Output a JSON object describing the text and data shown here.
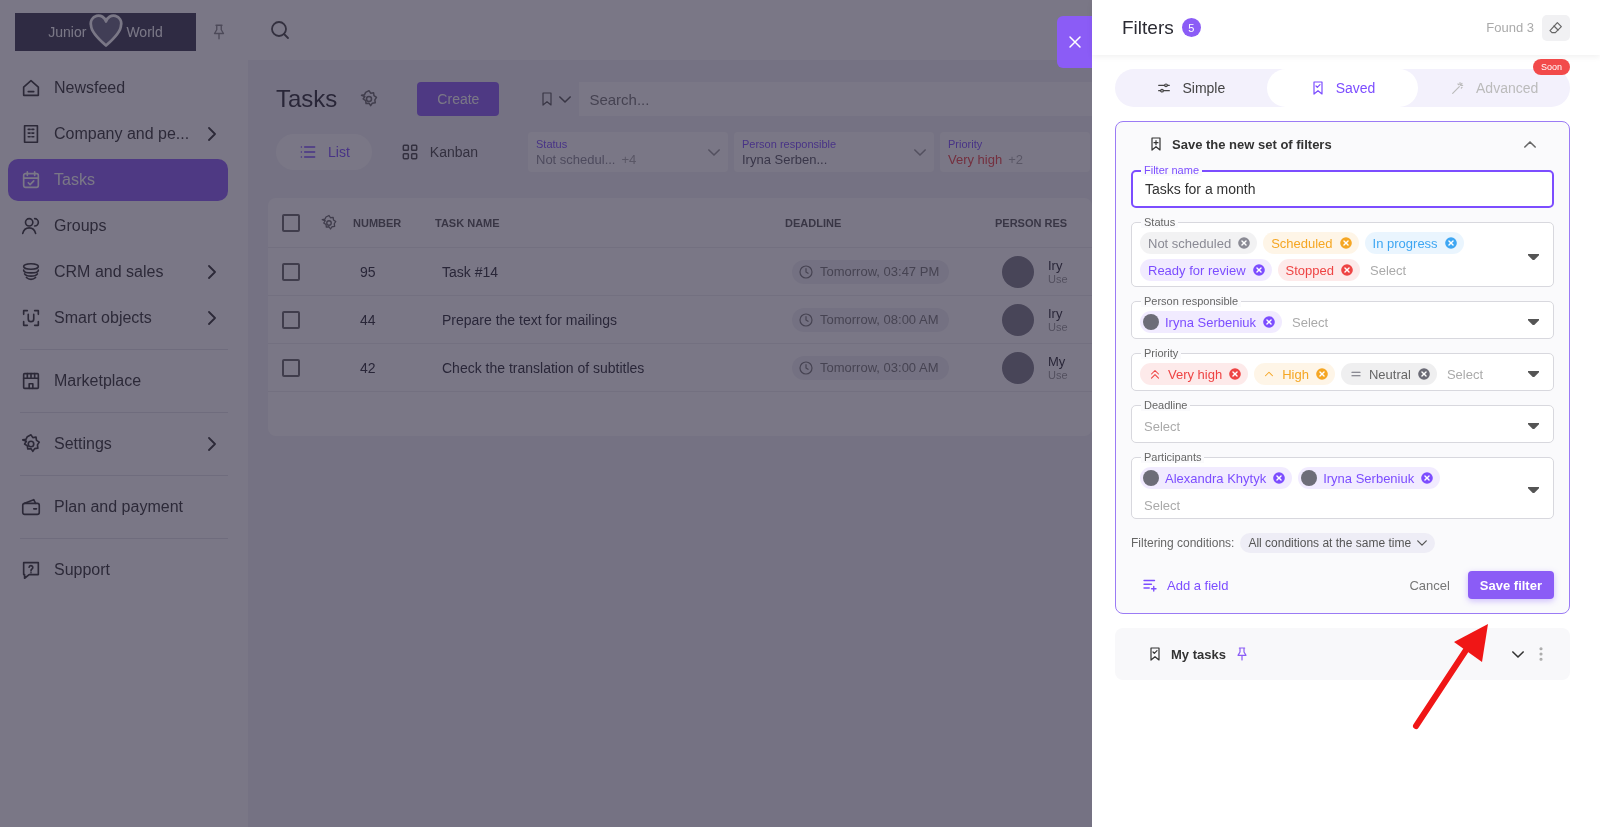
{
  "sidebar": {
    "logo": {
      "left": "Junior",
      "right": "World"
    },
    "sections": [
      [
        {
          "label": "Newsfeed",
          "selected": false,
          "has_submenu": false
        },
        {
          "label": "Company and pe...",
          "selected": false,
          "has_submenu": true
        },
        {
          "label": "Tasks",
          "selected": true,
          "has_submenu": false
        },
        {
          "label": "Groups",
          "selected": false,
          "has_submenu": false
        },
        {
          "label": "CRM and sales",
          "selected": false,
          "has_submenu": true
        },
        {
          "label": "Smart objects",
          "selected": false,
          "has_submenu": true
        }
      ],
      [
        {
          "label": "Marketplace",
          "selected": false,
          "has_submenu": false
        }
      ],
      [
        {
          "label": "Settings",
          "selected": false,
          "has_submenu": true
        }
      ],
      [
        {
          "label": "Plan and payment",
          "selected": false,
          "has_submenu": false
        }
      ],
      [
        {
          "label": "Support",
          "selected": false,
          "has_submenu": false
        }
      ]
    ]
  },
  "main": {
    "title": "Tasks",
    "create_button": "Create",
    "search": {
      "placeholder": "Search..."
    },
    "views": [
      {
        "label": "List",
        "selected": true
      },
      {
        "label": "Kanban",
        "selected": false
      }
    ],
    "filters": [
      {
        "kind": "status",
        "label": "Status",
        "value": "Not schedul...",
        "extra": "+4"
      },
      {
        "kind": "person",
        "label": "Person responsible",
        "value": "Iryna Serben..."
      },
      {
        "kind": "priority",
        "label": "Priority",
        "value": "Very high",
        "extra": "+2"
      }
    ],
    "table": {
      "select_all": {
        "checked": false
      },
      "columns": [
        "NUMBER",
        "TASK NAME",
        "DEADLINE",
        "PERSON RES"
      ],
      "rows": [
        {
          "checked": false,
          "number": "95",
          "task": "Task #14",
          "deadline": "Tomorrow, 03:47 PM",
          "person": "Iry",
          "role": "Use"
        },
        {
          "checked": false,
          "number": "44",
          "task": "Prepare the text for mailings",
          "deadline": "Tomorrow, 08:00 AM",
          "person": "Iry",
          "role": "Use"
        },
        {
          "checked": false,
          "number": "42",
          "task": "Check the translation of subtitles",
          "deadline": "Tomorrow, 03:00 AM",
          "person": "My",
          "role": "Use"
        }
      ]
    }
  },
  "drawer": {
    "title": "Filters",
    "count": "5",
    "found": "Found 3",
    "tabs": [
      {
        "label": "Simple",
        "selected": false,
        "disabled": false
      },
      {
        "label": "Saved",
        "selected": true,
        "disabled": false
      },
      {
        "label": "Advanced",
        "selected": false,
        "disabled": true,
        "badge": "Soon"
      }
    ],
    "new_set": {
      "title": "Save the new set of filters",
      "expanded": true,
      "name_field": {
        "label": "Filter name",
        "value": "Tasks for a month",
        "focused": true
      },
      "fields": [
        {
          "label": "Status",
          "placeholder": "Select",
          "wrap_placeholder": false,
          "chips": [
            {
              "kind": "status",
              "label": "Not scheduled",
              "color": "#8a8a94"
            },
            {
              "kind": "status",
              "label": "Scheduled",
              "color": "#f5a623"
            },
            {
              "kind": "status",
              "label": "In progress",
              "color": "#3ea6f2"
            },
            {
              "kind": "status",
              "label": "Ready for review",
              "color": "#7c4dff"
            },
            {
              "kind": "status",
              "label": "Stopped",
              "color": "#ee4444"
            }
          ]
        },
        {
          "label": "Person responsible",
          "placeholder": "Select",
          "wrap_placeholder": false,
          "chips": [
            {
              "kind": "person",
              "label": "Iryna Serbeniuk",
              "color": "#7c4dff"
            }
          ]
        },
        {
          "label": "Priority",
          "placeholder": "Select",
          "wrap_placeholder": false,
          "chips": [
            {
              "kind": "very_high",
              "label": "Very high",
              "color": "#ee4444"
            },
            {
              "kind": "high",
              "label": "High",
              "color": "#f5a623"
            },
            {
              "kind": "neutral",
              "label": "Neutral",
              "color": "#6b6b76"
            }
          ]
        },
        {
          "label": "Deadline",
          "placeholder": "Select",
          "wrap_placeholder": false
        },
        {
          "label": "Participants",
          "placeholder": "Select",
          "wrap_placeholder": true,
          "chips": [
            {
              "kind": "person",
              "label": "Alexandra Khytyk",
              "color": "#7c4dff"
            },
            {
              "kind": "person",
              "label": "Iryna Serbeniuk",
              "color": "#7c4dff"
            }
          ]
        }
      ],
      "conditions": {
        "label": "Filtering conditions:",
        "value": "All conditions at the same time"
      },
      "add_field": "Add a field",
      "cancel": "Cancel",
      "save": "Save filter"
    },
    "saved": [
      {
        "title": "My tasks",
        "pinned": true,
        "expanded": false
      }
    ]
  }
}
